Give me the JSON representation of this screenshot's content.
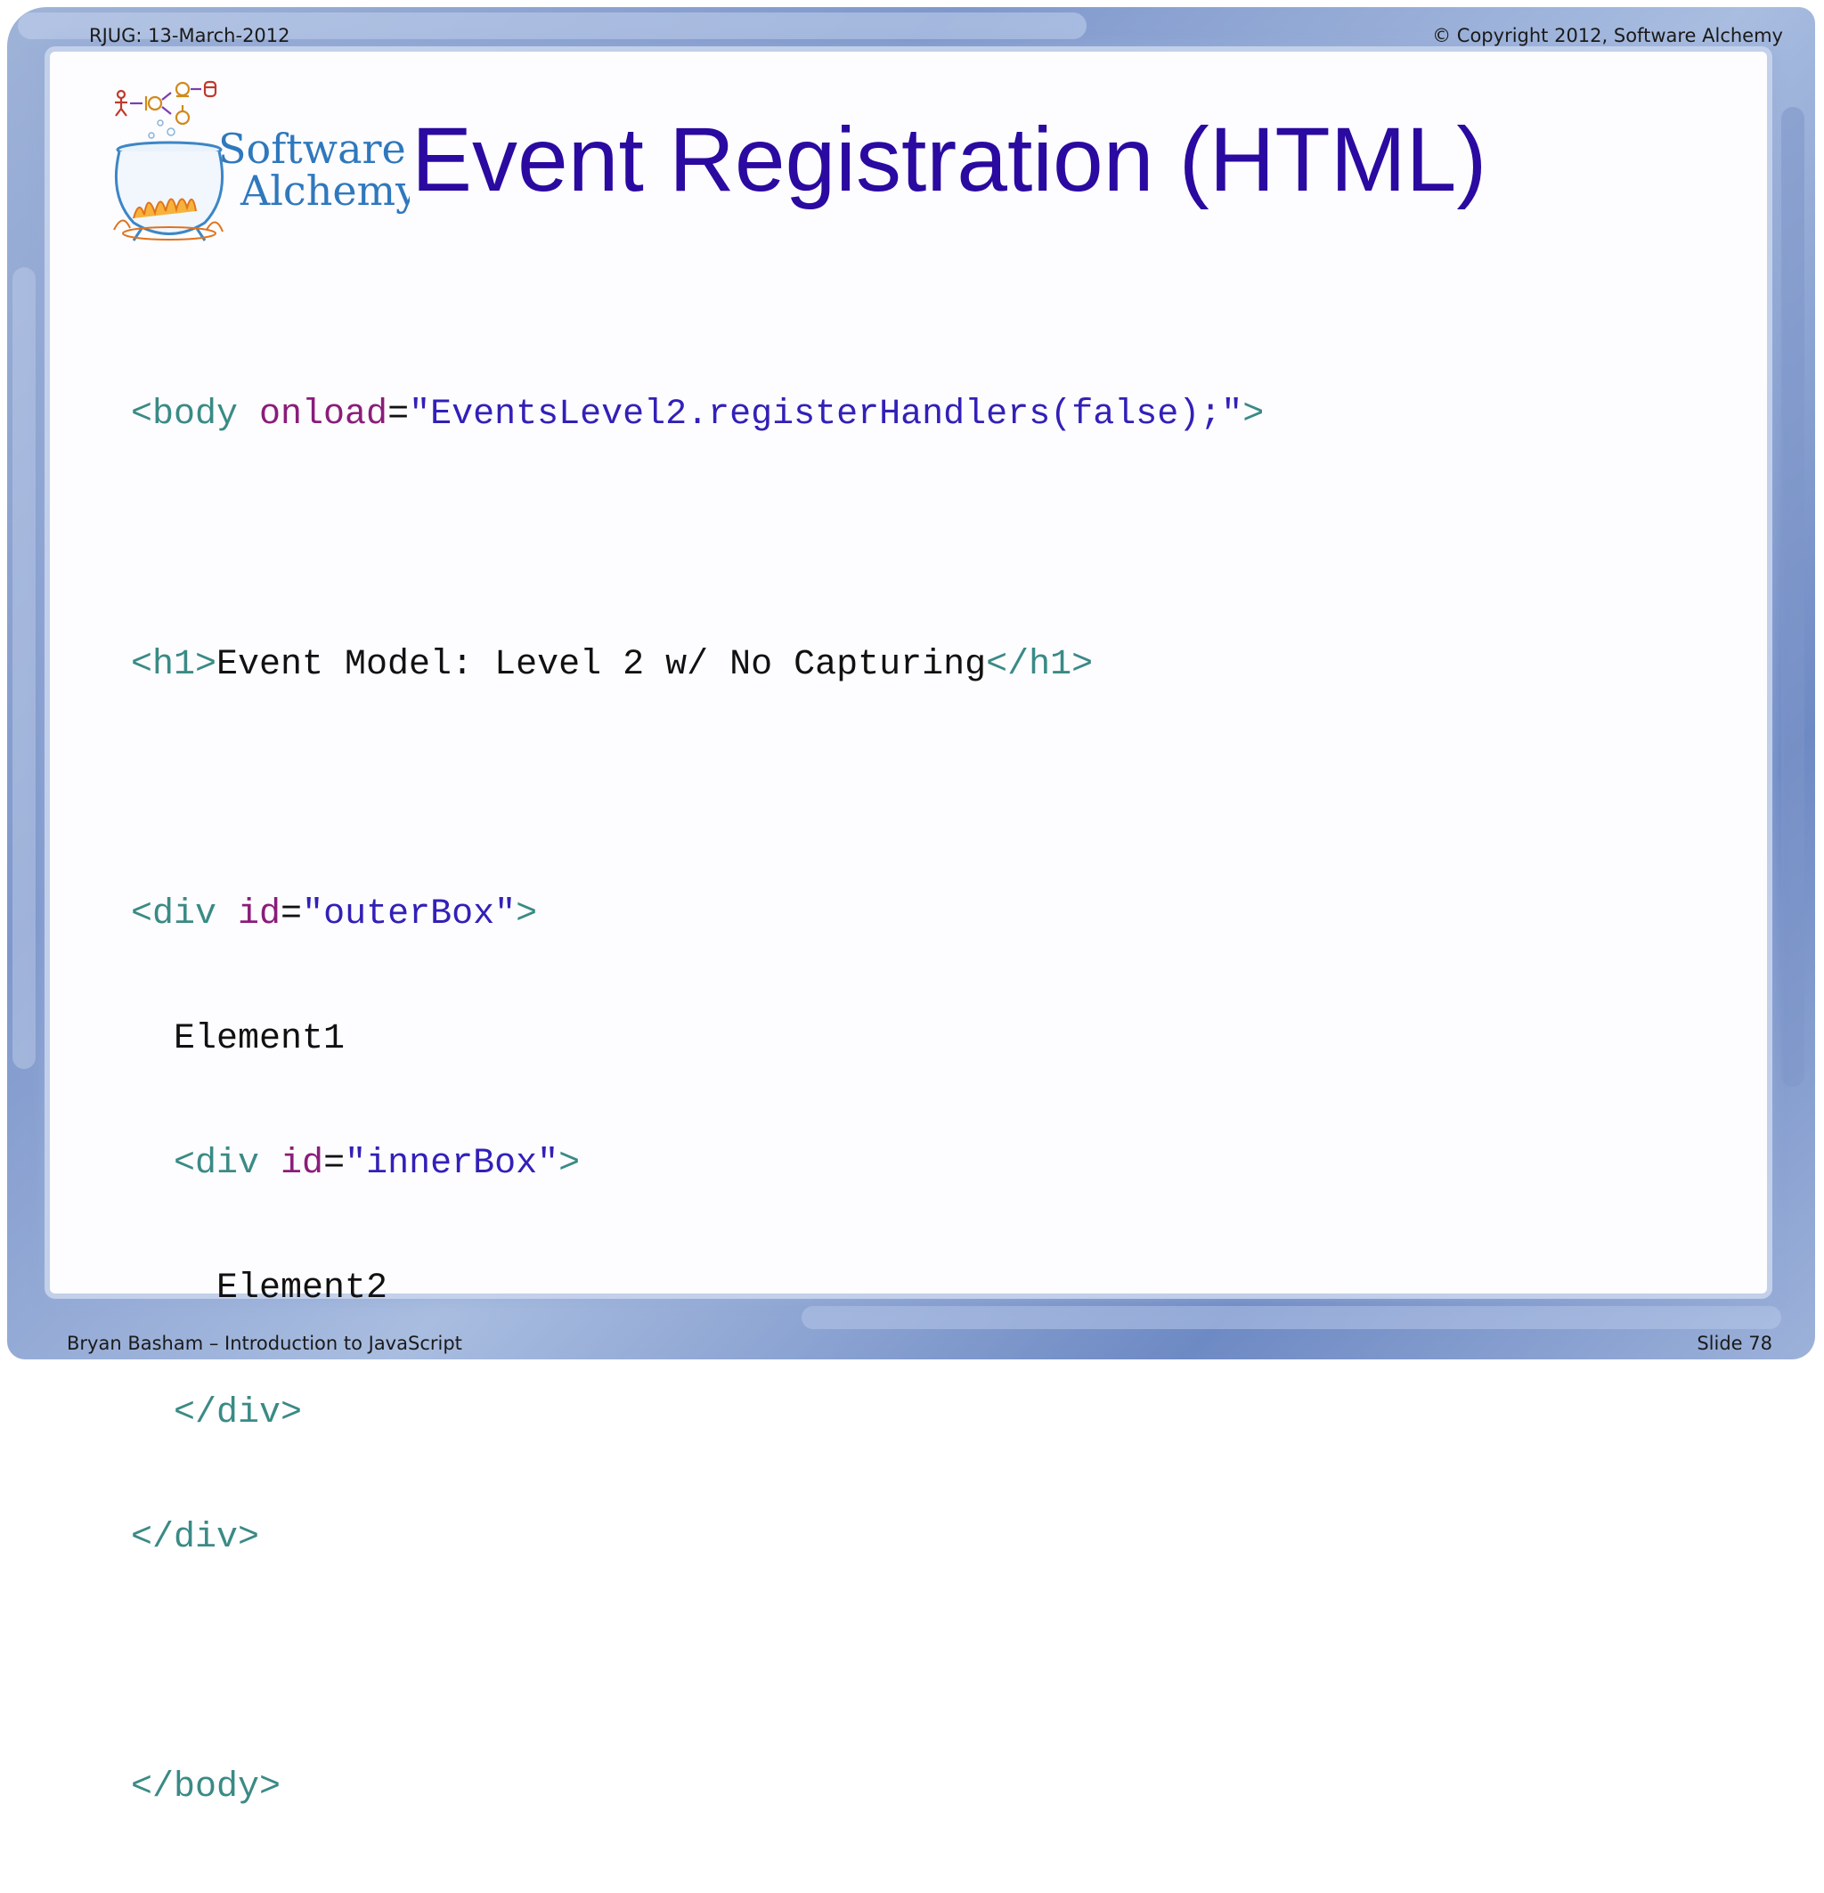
{
  "header": {
    "left": "RJUG:  13-March-2012",
    "right": "© Copyright 2012, Software Alchemy"
  },
  "footer": {
    "left": "Bryan Basham – Introduction to JavaScript",
    "right": "Slide 78"
  },
  "logo": {
    "line1": "Software",
    "line2": "Alchemy"
  },
  "title": "Event Registration (HTML)",
  "colors": {
    "title": "#2a0aa0",
    "tag": "#3a8a86",
    "attribute": "#8b1c7a",
    "value": "#3220b8",
    "text": "#111111",
    "frame": "#8fa6d4"
  },
  "code": {
    "line1": {
      "open": "<body ",
      "attr": "onload",
      "eq": "=",
      "value": "\"EventsLevel2.registerHandlers(false);\"",
      "close": ">"
    },
    "line2": {
      "open": "<h1>",
      "text": "Event Model: Level 2 w/ No Capturing",
      "close": "</h1>"
    },
    "line3": {
      "open": "<div ",
      "attr": "id",
      "eq": "=",
      "value": "\"outerBox\"",
      "close": ">"
    },
    "line4": {
      "indent": "  ",
      "text": "Element1"
    },
    "line5": {
      "indent": "  ",
      "open": "<div ",
      "attr": "id",
      "eq": "=",
      "value": "\"innerBox\"",
      "close": ">"
    },
    "line6": {
      "indent": "    ",
      "text": "Element2"
    },
    "line7": {
      "indent": "  ",
      "close": "</div>"
    },
    "line8": {
      "close": "</div>"
    },
    "line9": {
      "close": "</body>"
    }
  }
}
